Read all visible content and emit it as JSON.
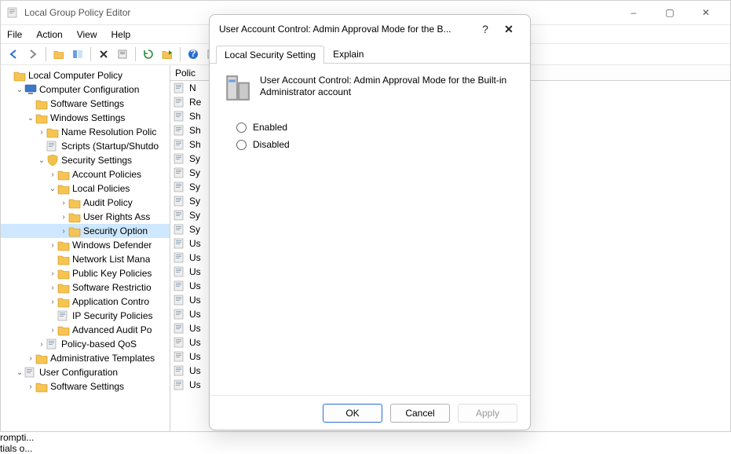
{
  "window": {
    "title": "Local Group Policy Editor",
    "controls": {
      "minimize": "–",
      "maximize": "▢",
      "close": "✕"
    }
  },
  "menubar": [
    "File",
    "Action",
    "View",
    "Help"
  ],
  "tree": {
    "root": "Local Computer Policy",
    "nodes": [
      {
        "label": "Computer Configuration",
        "depth": 1,
        "expanded": true,
        "icon": "computer"
      },
      {
        "label": "Software Settings",
        "depth": 2,
        "leaf": true,
        "icon": "folder"
      },
      {
        "label": "Windows Settings",
        "depth": 2,
        "expanded": true,
        "icon": "folder"
      },
      {
        "label": "Name Resolution Polic",
        "depth": 3,
        "leaf": true,
        "icon": "folder",
        "hasChildren": true
      },
      {
        "label": "Scripts (Startup/Shutdo",
        "depth": 3,
        "leaf": true,
        "icon": "script"
      },
      {
        "label": "Security Settings",
        "depth": 3,
        "expanded": true,
        "icon": "security"
      },
      {
        "label": "Account Policies",
        "depth": 4,
        "leaf": true,
        "icon": "folder",
        "hasChildren": true
      },
      {
        "label": "Local Policies",
        "depth": 4,
        "expanded": true,
        "icon": "folder"
      },
      {
        "label": "Audit Policy",
        "depth": 5,
        "leaf": true,
        "icon": "folder",
        "hasChildren": true
      },
      {
        "label": "User Rights Ass",
        "depth": 5,
        "leaf": true,
        "icon": "folder",
        "hasChildren": true
      },
      {
        "label": "Security Option",
        "depth": 5,
        "leaf": true,
        "icon": "folder",
        "selected": true,
        "hasChildren": true
      },
      {
        "label": "Windows Defender",
        "depth": 4,
        "leaf": true,
        "icon": "folder",
        "hasChildren": true
      },
      {
        "label": "Network List Mana",
        "depth": 4,
        "leaf": true,
        "icon": "folder"
      },
      {
        "label": "Public Key Policies",
        "depth": 4,
        "leaf": true,
        "icon": "folder",
        "hasChildren": true
      },
      {
        "label": "Software Restrictio",
        "depth": 4,
        "leaf": true,
        "icon": "folder",
        "hasChildren": true
      },
      {
        "label": "Application Contro",
        "depth": 4,
        "leaf": true,
        "icon": "folder",
        "hasChildren": true
      },
      {
        "label": "IP Security Policies",
        "depth": 4,
        "leaf": true,
        "icon": "ipsec"
      },
      {
        "label": "Advanced Audit Po",
        "depth": 4,
        "leaf": true,
        "icon": "folder",
        "hasChildren": true
      },
      {
        "label": "Policy-based QoS",
        "depth": 3,
        "leaf": true,
        "icon": "qos",
        "hasChildren": true
      },
      {
        "label": "Administrative Templates",
        "depth": 2,
        "leaf": true,
        "icon": "folder",
        "hasChildren": true
      },
      {
        "label": "User Configuration",
        "depth": 1,
        "expanded": true,
        "icon": "user"
      },
      {
        "label": "Software Settings",
        "depth": 2,
        "leaf": true,
        "icon": "folder",
        "hasChildren": true
      }
    ]
  },
  "list": {
    "header": "Polic",
    "partials": [
      "N",
      "Re",
      "Sh",
      "Sh",
      "Sh",
      "Sy",
      "Sy",
      "Sy",
      "Sy",
      "Sy",
      "Sy",
      "Us",
      "Us",
      "Us",
      "Us",
      "Us",
      "Us",
      "Us",
      "Us",
      "Us",
      "Us",
      "Us"
    ],
    "rightFragments": [
      "rompti...",
      "tials o..."
    ]
  },
  "dialog": {
    "title": "User Account Control: Admin Approval Mode for the B...",
    "tabs": {
      "local": "Local Security Setting",
      "explain": "Explain"
    },
    "policyName": "User Account Control: Admin Approval Mode for the Built-in Administrator account",
    "options": {
      "enabled": "Enabled",
      "disabled": "Disabled"
    },
    "buttons": {
      "ok": "OK",
      "cancel": "Cancel",
      "apply": "Apply"
    }
  }
}
